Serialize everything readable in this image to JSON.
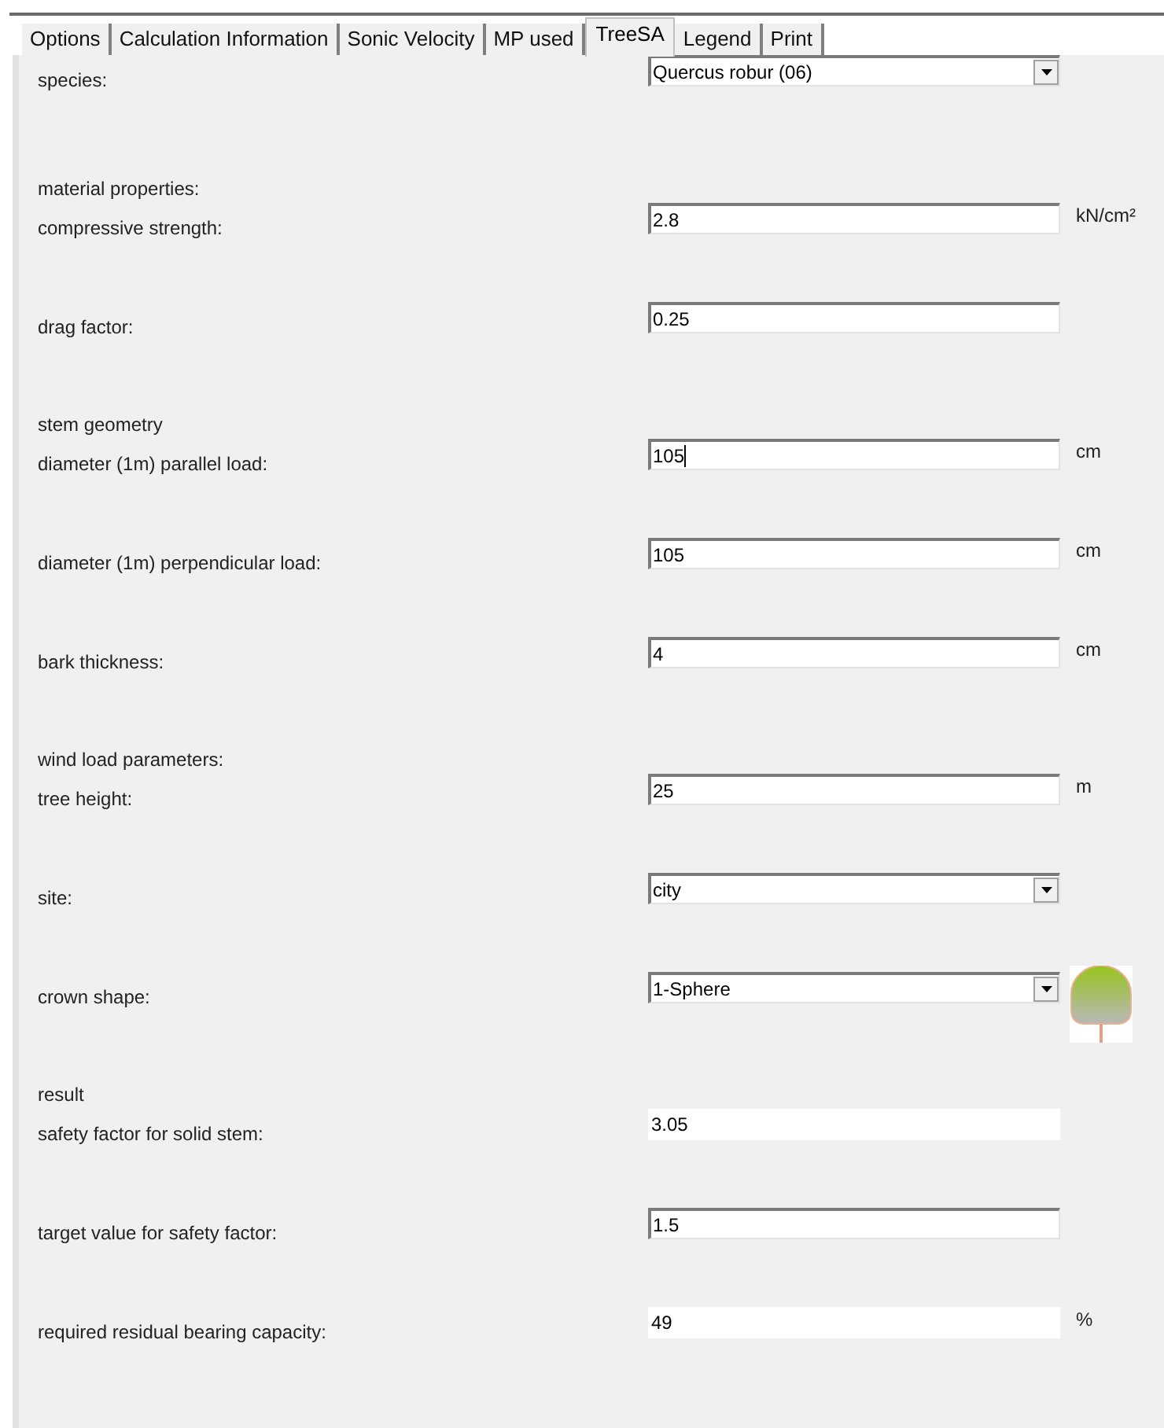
{
  "tabs": [
    {
      "label": "Options",
      "selected": false
    },
    {
      "label": "Calculation Information",
      "selected": false
    },
    {
      "label": "Sonic Velocity",
      "selected": false
    },
    {
      "label": "MP used",
      "selected": false
    },
    {
      "label": "TreeSA",
      "selected": true
    },
    {
      "label": "Legend",
      "selected": false
    },
    {
      "label": "Print",
      "selected": false
    }
  ],
  "sections": [
    {
      "fields": [
        {
          "kind": "combo",
          "label": "species:",
          "value": "Quercus robur (06)"
        }
      ]
    },
    {
      "header": "material properties:",
      "fields": [
        {
          "kind": "input",
          "label": "compressive strength:",
          "value": "2.8",
          "unit": "kN/cm²",
          "focused": false
        },
        {
          "kind": "input",
          "label": "drag factor:",
          "value": "0.25",
          "focused": false
        }
      ]
    },
    {
      "header": "stem geometry",
      "fields": [
        {
          "kind": "input",
          "label": "diameter (1m) parallel load:",
          "value": "105",
          "unit": "cm",
          "focused": true
        },
        {
          "kind": "input",
          "label": "diameter (1m) perpendicular load:",
          "value": "105",
          "unit": "cm",
          "focused": false
        },
        {
          "kind": "input",
          "label": "bark thickness:",
          "value": "4",
          "unit": "cm",
          "focused": false
        }
      ]
    },
    {
      "header": "wind load parameters:",
      "fields": [
        {
          "kind": "input",
          "label": "tree height:",
          "value": "25",
          "unit": "m",
          "focused": false
        },
        {
          "kind": "combo",
          "label": "site:",
          "value": "city"
        },
        {
          "kind": "combo-preview",
          "label": "crown shape:",
          "value": "1-Sphere"
        }
      ]
    },
    {
      "header": "result",
      "fields": [
        {
          "kind": "readonly",
          "label": "safety factor for solid stem:",
          "value": "3.05"
        },
        {
          "kind": "input",
          "label": "target value for safety factor:",
          "value": "1.5",
          "focused": false
        },
        {
          "kind": "readonly",
          "label": "required residual bearing capacity:",
          "value": "49",
          "unit": "%"
        }
      ]
    }
  ]
}
